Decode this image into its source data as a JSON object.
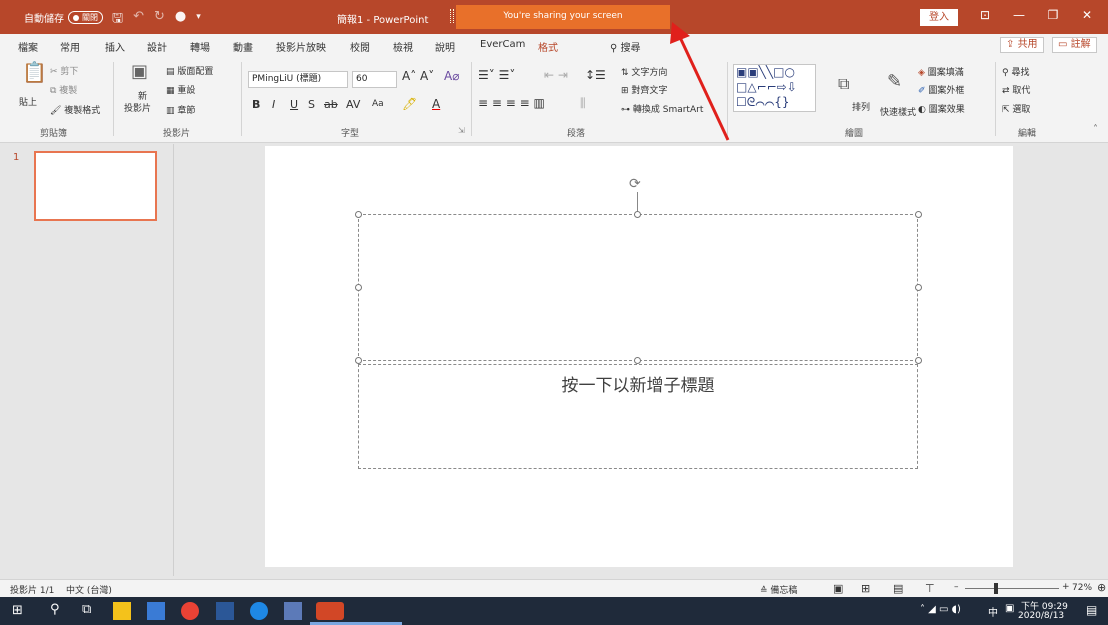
{
  "titlebar": {
    "autosave_label": "自動儲存",
    "autosave_state": "關閉",
    "doc_title": "簡報1 - PowerPoint",
    "share_banner": "You're sharing your screen",
    "signin": "登入"
  },
  "menu": {
    "tabs": [
      "檔案",
      "常用",
      "插入",
      "設計",
      "轉場",
      "動畫",
      "投影片放映",
      "校閱",
      "檢視",
      "說明",
      "EverCam",
      "格式"
    ],
    "active_tab": "常用",
    "search": "搜尋",
    "share": "共用",
    "comments": "註解"
  },
  "ribbon": {
    "clipboard": {
      "paste": "貼上",
      "cut": "剪下",
      "copy": "複製",
      "format_painter": "複製格式",
      "label": "剪貼簿"
    },
    "slides": {
      "new": "新",
      "new2": "投影片",
      "layout": "版面配置",
      "reset": "重設",
      "section": "章節",
      "label": "投影片"
    },
    "font": {
      "name": "PMingLiU (標題)",
      "size": "60",
      "label": "字型",
      "aa": "Aa"
    },
    "paragraph": {
      "text_direction": "文字方向",
      "align_text": "對齊文字",
      "smartart": "轉換成 SmartArt",
      "label": "段落"
    },
    "drawing": {
      "arrange": "排列",
      "quick_styles": "快速樣式",
      "fill": "圖案填滿",
      "outline": "圖案外框",
      "effects": "圖案效果",
      "label": "繪圖"
    },
    "editing": {
      "find": "尋找",
      "replace": "取代",
      "select": "選取",
      "label": "編輯"
    }
  },
  "slides_pane": {
    "slide_number": "1"
  },
  "slide": {
    "subtitle_placeholder": "按一下以新增子標題"
  },
  "status": {
    "slide_info": "投影片 1/1",
    "language": "中文 (台灣)",
    "notes": "備忘稿",
    "zoom": "72%"
  },
  "taskbar": {
    "time": "下午 09:29",
    "date": "2020/8/13",
    "ime": "中"
  },
  "colors": {
    "accent": "#b7472a",
    "share_banner": "#e8702a",
    "taskbar": "#1f2a3a"
  }
}
